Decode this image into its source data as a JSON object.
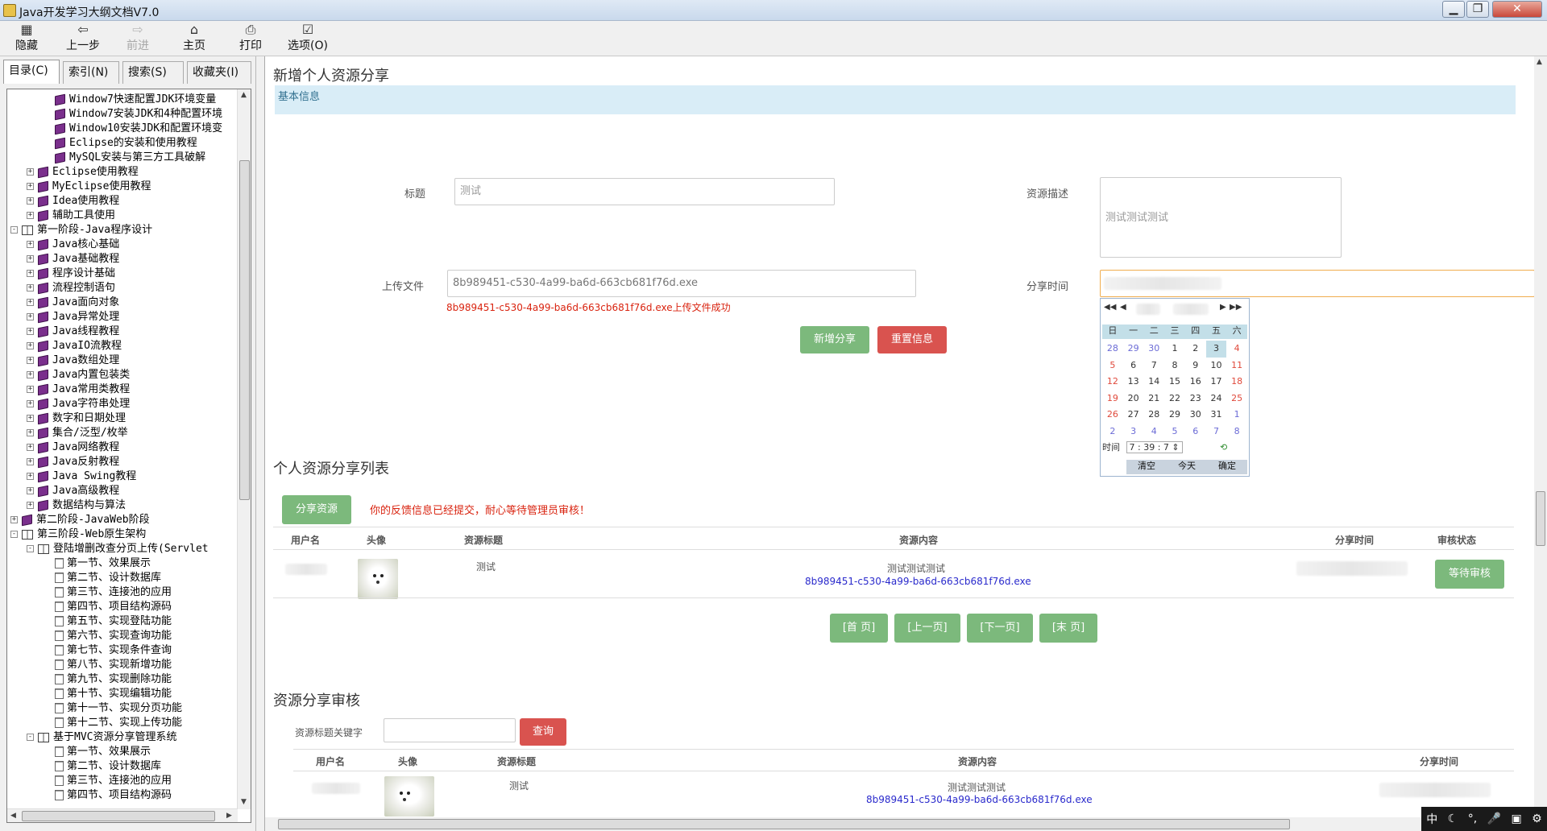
{
  "window": {
    "title": "Java开发学习大纲文档V7.0",
    "min": "▁",
    "max": "❐",
    "close": "✕"
  },
  "toolbar": {
    "hide": "隐藏",
    "back": "上一步",
    "forward": "前进",
    "home": "主页",
    "print": "打印",
    "options": "选项(O)"
  },
  "left_tabs": [
    "目录(C)",
    "索引(N)",
    "搜索(S)",
    "收藏夹(I)"
  ],
  "tree": [
    {
      "indent": 2,
      "exp": "",
      "icon": "book",
      "label": "Window7快速配置JDK环境变量"
    },
    {
      "indent": 2,
      "exp": "",
      "icon": "book",
      "label": "Window7安装JDK和4种配置环境"
    },
    {
      "indent": 2,
      "exp": "",
      "icon": "book",
      "label": "Window10安装JDK和配置环境变"
    },
    {
      "indent": 2,
      "exp": "",
      "icon": "book",
      "label": "Eclipse的安装和使用教程"
    },
    {
      "indent": 2,
      "exp": "",
      "icon": "book",
      "label": "MySQL安装与第三方工具破解"
    },
    {
      "indent": 1,
      "exp": "+",
      "icon": "book",
      "label": "Eclipse使用教程"
    },
    {
      "indent": 1,
      "exp": "+",
      "icon": "book",
      "label": "MyEclipse使用教程"
    },
    {
      "indent": 1,
      "exp": "+",
      "icon": "book",
      "label": "Idea使用教程"
    },
    {
      "indent": 1,
      "exp": "+",
      "icon": "book",
      "label": "辅助工具使用"
    },
    {
      "indent": 0,
      "exp": "-",
      "icon": "openbook",
      "label": "第一阶段-Java程序设计"
    },
    {
      "indent": 1,
      "exp": "+",
      "icon": "book",
      "label": "Java核心基础"
    },
    {
      "indent": 1,
      "exp": "+",
      "icon": "book",
      "label": "Java基础教程"
    },
    {
      "indent": 1,
      "exp": "+",
      "icon": "book",
      "label": "程序设计基础"
    },
    {
      "indent": 1,
      "exp": "+",
      "icon": "book",
      "label": "流程控制语句"
    },
    {
      "indent": 1,
      "exp": "+",
      "icon": "book",
      "label": "Java面向对象"
    },
    {
      "indent": 1,
      "exp": "+",
      "icon": "book",
      "label": "Java异常处理"
    },
    {
      "indent": 1,
      "exp": "+",
      "icon": "book",
      "label": "Java线程教程"
    },
    {
      "indent": 1,
      "exp": "+",
      "icon": "book",
      "label": "JavaIO流教程"
    },
    {
      "indent": 1,
      "exp": "+",
      "icon": "book",
      "label": "Java数组处理"
    },
    {
      "indent": 1,
      "exp": "+",
      "icon": "book",
      "label": "Java内置包装类"
    },
    {
      "indent": 1,
      "exp": "+",
      "icon": "book",
      "label": "Java常用类教程"
    },
    {
      "indent": 1,
      "exp": "+",
      "icon": "book",
      "label": "Java字符串处理"
    },
    {
      "indent": 1,
      "exp": "+",
      "icon": "book",
      "label": "数字和日期处理"
    },
    {
      "indent": 1,
      "exp": "+",
      "icon": "book",
      "label": "集合/泛型/枚举"
    },
    {
      "indent": 1,
      "exp": "+",
      "icon": "book",
      "label": "Java网络教程"
    },
    {
      "indent": 1,
      "exp": "+",
      "icon": "book",
      "label": "Java反射教程"
    },
    {
      "indent": 1,
      "exp": "+",
      "icon": "book",
      "label": "Java Swing教程"
    },
    {
      "indent": 1,
      "exp": "+",
      "icon": "book",
      "label": "Java高级教程"
    },
    {
      "indent": 1,
      "exp": "+",
      "icon": "book",
      "label": "数据结构与算法"
    },
    {
      "indent": 0,
      "exp": "+",
      "icon": "book",
      "label": "第二阶段-JavaWeb阶段"
    },
    {
      "indent": 0,
      "exp": "-",
      "icon": "openbook",
      "label": "第三阶段-Web原生架构"
    },
    {
      "indent": 1,
      "exp": "-",
      "icon": "openbook",
      "label": "登陆增删改查分页上传(Servlet"
    },
    {
      "indent": 2,
      "exp": "",
      "icon": "page",
      "label": "第一节、效果展示"
    },
    {
      "indent": 2,
      "exp": "",
      "icon": "page",
      "label": "第二节、设计数据库"
    },
    {
      "indent": 2,
      "exp": "",
      "icon": "page",
      "label": "第三节、连接池的应用"
    },
    {
      "indent": 2,
      "exp": "",
      "icon": "page",
      "label": "第四节、项目结构源码"
    },
    {
      "indent": 2,
      "exp": "",
      "icon": "page",
      "label": "第五节、实现登陆功能"
    },
    {
      "indent": 2,
      "exp": "",
      "icon": "page",
      "label": "第六节、实现查询功能"
    },
    {
      "indent": 2,
      "exp": "",
      "icon": "page",
      "label": "第七节、实现条件查询"
    },
    {
      "indent": 2,
      "exp": "",
      "icon": "page",
      "label": "第八节、实现新增功能"
    },
    {
      "indent": 2,
      "exp": "",
      "icon": "page",
      "label": "第九节、实现删除功能"
    },
    {
      "indent": 2,
      "exp": "",
      "icon": "page",
      "label": "第十节、实现编辑功能"
    },
    {
      "indent": 2,
      "exp": "",
      "icon": "page",
      "label": "第十一节、实现分页功能"
    },
    {
      "indent": 2,
      "exp": "",
      "icon": "page",
      "label": "第十二节、实现上传功能"
    },
    {
      "indent": 1,
      "exp": "-",
      "icon": "openbook",
      "label": "基于MVC资源分享管理系统"
    },
    {
      "indent": 2,
      "exp": "",
      "icon": "page",
      "label": "第一节、效果展示"
    },
    {
      "indent": 2,
      "exp": "",
      "icon": "page",
      "label": "第二节、设计数据库"
    },
    {
      "indent": 2,
      "exp": "",
      "icon": "page",
      "label": "第三节、连接池的应用"
    },
    {
      "indent": 2,
      "exp": "",
      "icon": "page",
      "label": "第四节、项目结构源码"
    }
  ],
  "form": {
    "heading": "新增个人资源分享",
    "section": "基本信息",
    "title_label": "标题",
    "title_value": "测试",
    "desc_label": "资源描述",
    "desc_value": "测试测试测试",
    "file_label": "上传文件",
    "file_value": "8b989451-c530-4a99-ba6d-663cb681f76d.exe",
    "upload_msg": "8b989451-c530-4a99-ba6d-663cb681f76d.exe上传文件成功",
    "time_label": "分享时间",
    "submit": "新增分享",
    "reset": "重置信息"
  },
  "calendar": {
    "weekdays": [
      "日",
      "一",
      "二",
      "三",
      "四",
      "五",
      "六"
    ],
    "rows": [
      [
        "28",
        "29",
        "30",
        "1",
        "2",
        "3",
        "4"
      ],
      [
        "5",
        "6",
        "7",
        "8",
        "9",
        "10",
        "11"
      ],
      [
        "12",
        "13",
        "14",
        "15",
        "16",
        "17",
        "18"
      ],
      [
        "19",
        "20",
        "21",
        "22",
        "23",
        "24",
        "25"
      ],
      [
        "26",
        "27",
        "28",
        "29",
        "30",
        "31",
        "1"
      ],
      [
        "2",
        "3",
        "4",
        "5",
        "6",
        "7",
        "8"
      ]
    ],
    "time_label": "时间",
    "hh": "7",
    "mm": "39",
    "ss": "7",
    "clear": "清空",
    "today": "今天",
    "ok": "确定"
  },
  "list": {
    "heading": "个人资源分享列表",
    "share_btn": "分享资源",
    "notice": "你的反馈信息已经提交，耐心等待管理员审核！",
    "cols": [
      "用户名",
      "头像",
      "资源标题",
      "资源内容",
      "分享时间",
      "审核状态"
    ],
    "row": {
      "title": "测试",
      "content": "测试测试测试",
      "file": "8b989451-c530-4a99-ba6d-663cb681f76d.exe",
      "status": "等待审核"
    },
    "pager": [
      "[首 页]",
      "[上一页]",
      "[下一页]",
      "[末 页]"
    ]
  },
  "review": {
    "heading": "资源分享审核",
    "search_label": "资源标题关键字",
    "search_btn": "查询",
    "cols": [
      "用户名",
      "头像",
      "资源标题",
      "资源内容",
      "分享时间"
    ],
    "row": {
      "title": "测试",
      "content": "测试测试测试",
      "file": "8b989451-c530-4a99-ba6d-663cb681f76d.exe"
    }
  },
  "ime": [
    "中",
    "☾",
    "°,",
    "🎤",
    "▣",
    "⚙"
  ]
}
